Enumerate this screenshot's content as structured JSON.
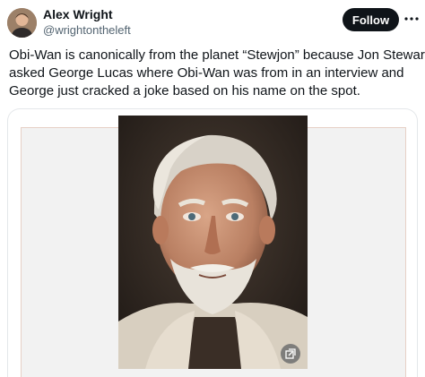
{
  "author": {
    "name": "Alex Wright",
    "handle": "@wrightontheleft"
  },
  "follow_label": "Follow",
  "tweet": {
    "lines": [
      "Obi-Wan is canonically from the planet “Stewjon” because Jon Stewart",
      "asked George Lucas where Obi-Wan was from in an interview and",
      "George just cracked a joke based on his name on the spot."
    ]
  },
  "icons": {
    "more": "more-horizontal-icon",
    "expand": "expand-image-icon"
  },
  "colors": {
    "text": "#0f1419",
    "secondary": "#536471",
    "button": "#0f1419"
  }
}
